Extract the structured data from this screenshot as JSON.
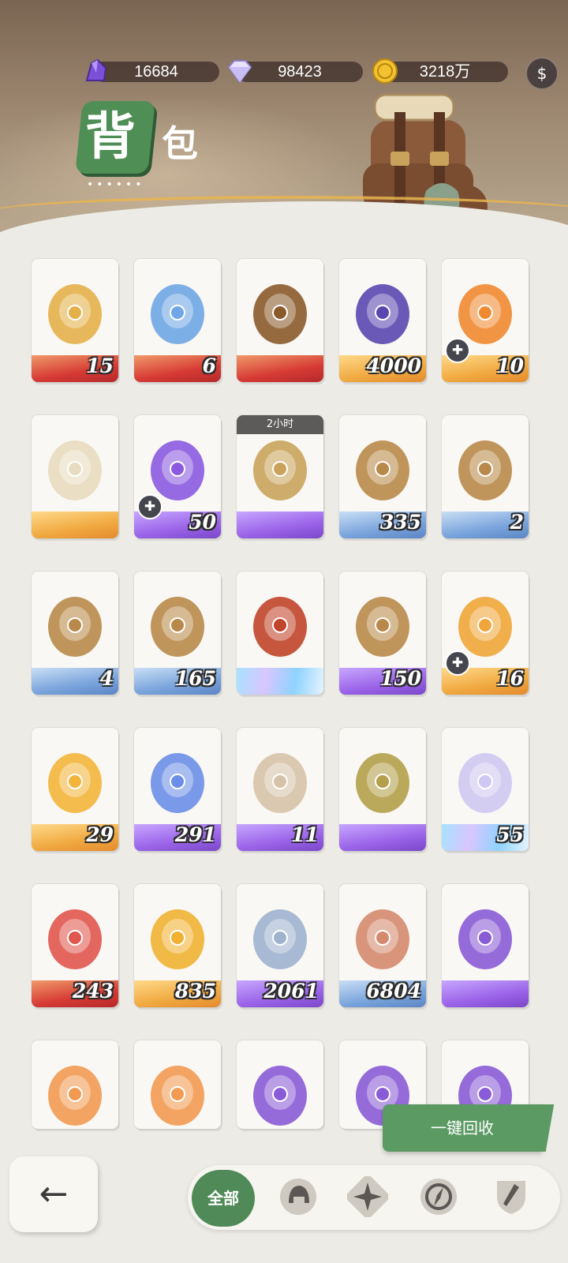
{
  "resources": [
    {
      "name": "amethyst",
      "icon": "purple-crystal-icon",
      "value": "16684"
    },
    {
      "name": "diamond",
      "icon": "diamond-icon",
      "value": "98423"
    },
    {
      "name": "gold",
      "icon": "gold-coin-icon",
      "value": "3218万"
    }
  ],
  "title": {
    "main": "背",
    "sub": "包",
    "dots": "••••••"
  },
  "bag_button_icon": "money-bag-icon",
  "items": [
    {
      "icon": "red-envelope-icon",
      "qty": "15",
      "band": "red",
      "puzzle": false
    },
    {
      "icon": "blue-winged-orb-icon",
      "qty": "6",
      "band": "red",
      "puzzle": false
    },
    {
      "icon": "dark-envelope-icon",
      "qty": "",
      "band": "red",
      "puzzle": false
    },
    {
      "icon": "balloon-ticket-icon",
      "qty": "4000",
      "band": "gold",
      "puzzle": false
    },
    {
      "icon": "fire-trident-orb-icon",
      "qty": "10",
      "band": "gold",
      "puzzle": true
    },
    {
      "icon": "white-envelope-icon",
      "qty": "",
      "band": "gold",
      "puzzle": false
    },
    {
      "icon": "purple-trident-orb-icon",
      "qty": "50",
      "band": "purple",
      "puzzle": true
    },
    {
      "icon": "hourglass-icon",
      "qty": "",
      "band": "purple",
      "puzzle": false,
      "timer": "2小时"
    },
    {
      "icon": "acorn-green-eye-icon",
      "qty": "335",
      "band": "blue",
      "puzzle": false
    },
    {
      "icon": "acorn-target-icon",
      "qty": "2",
      "band": "blue",
      "puzzle": false
    },
    {
      "icon": "acorn-leaf-icon",
      "qty": "4",
      "band": "blue",
      "puzzle": false
    },
    {
      "icon": "acorn-star-icon",
      "qty": "165",
      "band": "blue",
      "puzzle": false
    },
    {
      "icon": "treasure-chest-icon",
      "qty": "",
      "band": "crystal",
      "puzzle": false
    },
    {
      "icon": "acorn-diamond-icon",
      "qty": "150",
      "band": "purple",
      "puzzle": false
    },
    {
      "icon": "orange-rune-shard-icon",
      "qty": "16",
      "band": "gold",
      "puzzle": true
    },
    {
      "icon": "gold-rune-shard-icon",
      "qty": "29",
      "band": "gold",
      "puzzle": false
    },
    {
      "icon": "blue-rune-shard-icon",
      "qty": "291",
      "band": "purple",
      "puzzle": false
    },
    {
      "icon": "hamster-figure-icon",
      "qty": "11",
      "band": "purple",
      "puzzle": false
    },
    {
      "icon": "flower-bouquet-icon",
      "qty": "",
      "band": "purple",
      "puzzle": false
    },
    {
      "icon": "silver-ingot-icon",
      "qty": "55",
      "band": "crystal",
      "puzzle": false
    },
    {
      "icon": "red-ingot-icon",
      "qty": "243",
      "band": "red",
      "puzzle": false
    },
    {
      "icon": "gold-ingot-icon",
      "qty": "835",
      "band": "gold",
      "puzzle": false
    },
    {
      "icon": "steel-ingot-icon",
      "qty": "2061",
      "band": "purple",
      "puzzle": false
    },
    {
      "icon": "copper-ingot-icon",
      "qty": "6804",
      "band": "blue",
      "puzzle": false
    },
    {
      "icon": "purple-rune-portal-icon",
      "qty": "",
      "band": "purple",
      "puzzle": false
    },
    {
      "icon": "fire-portrait-girl-icon",
      "qty": "",
      "band": "gold",
      "puzzle": false
    },
    {
      "icon": "fire-portrait-man-icon",
      "qty": "",
      "band": "gold",
      "puzzle": false
    },
    {
      "icon": "purple-portrait-ruins-icon",
      "qty": "",
      "band": "purple",
      "puzzle": false
    },
    {
      "icon": "purple-portrait-dark-icon",
      "qty": "",
      "band": "purple",
      "puzzle": false
    },
    {
      "icon": "purple-portrait-orb-icon",
      "qty": "",
      "band": "purple",
      "puzzle": false
    }
  ],
  "recycle_label": "一键回收",
  "back_icon": "back-arrow-icon",
  "filters": {
    "all_label": "全部",
    "icons": [
      "helmet-filter-icon",
      "star-compass-filter-icon",
      "compass-filter-icon",
      "sword-shield-filter-icon"
    ]
  }
}
